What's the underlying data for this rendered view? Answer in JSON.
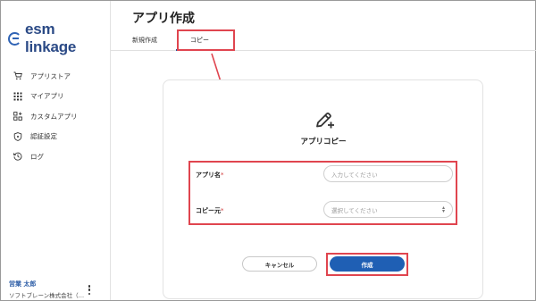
{
  "brand": {
    "logo_text": "esm linkage",
    "primary_color": "#2f63b5",
    "accent_highlight": "#e0454f"
  },
  "sidebar": {
    "items": [
      {
        "label": "アプリストア",
        "icon": "cart-icon"
      },
      {
        "label": "マイアプリ",
        "icon": "grid-icon"
      },
      {
        "label": "カスタムアプリ",
        "icon": "custom-apps-icon"
      },
      {
        "label": "認証設定",
        "icon": "shield-icon"
      },
      {
        "label": "ログ",
        "icon": "history-icon"
      }
    ],
    "user": {
      "name": "営業 太郎",
      "company": "ソフトブレーン株式会社（…"
    }
  },
  "header": {
    "title": "アプリ作成",
    "tabs": [
      {
        "label": "新規作成",
        "active": false
      },
      {
        "label": "コピー",
        "active": true
      }
    ]
  },
  "card": {
    "title": "アプリコピー",
    "icon": "edit-add-icon",
    "fields": {
      "app_name": {
        "label": "アプリ名",
        "required_mark": "*",
        "placeholder": "入力してください",
        "value": ""
      },
      "copy_source": {
        "label": "コピー元",
        "required_mark": "*",
        "placeholder": "選択してください",
        "value": ""
      }
    },
    "buttons": {
      "cancel": "キャンセル",
      "create": "作成"
    }
  }
}
